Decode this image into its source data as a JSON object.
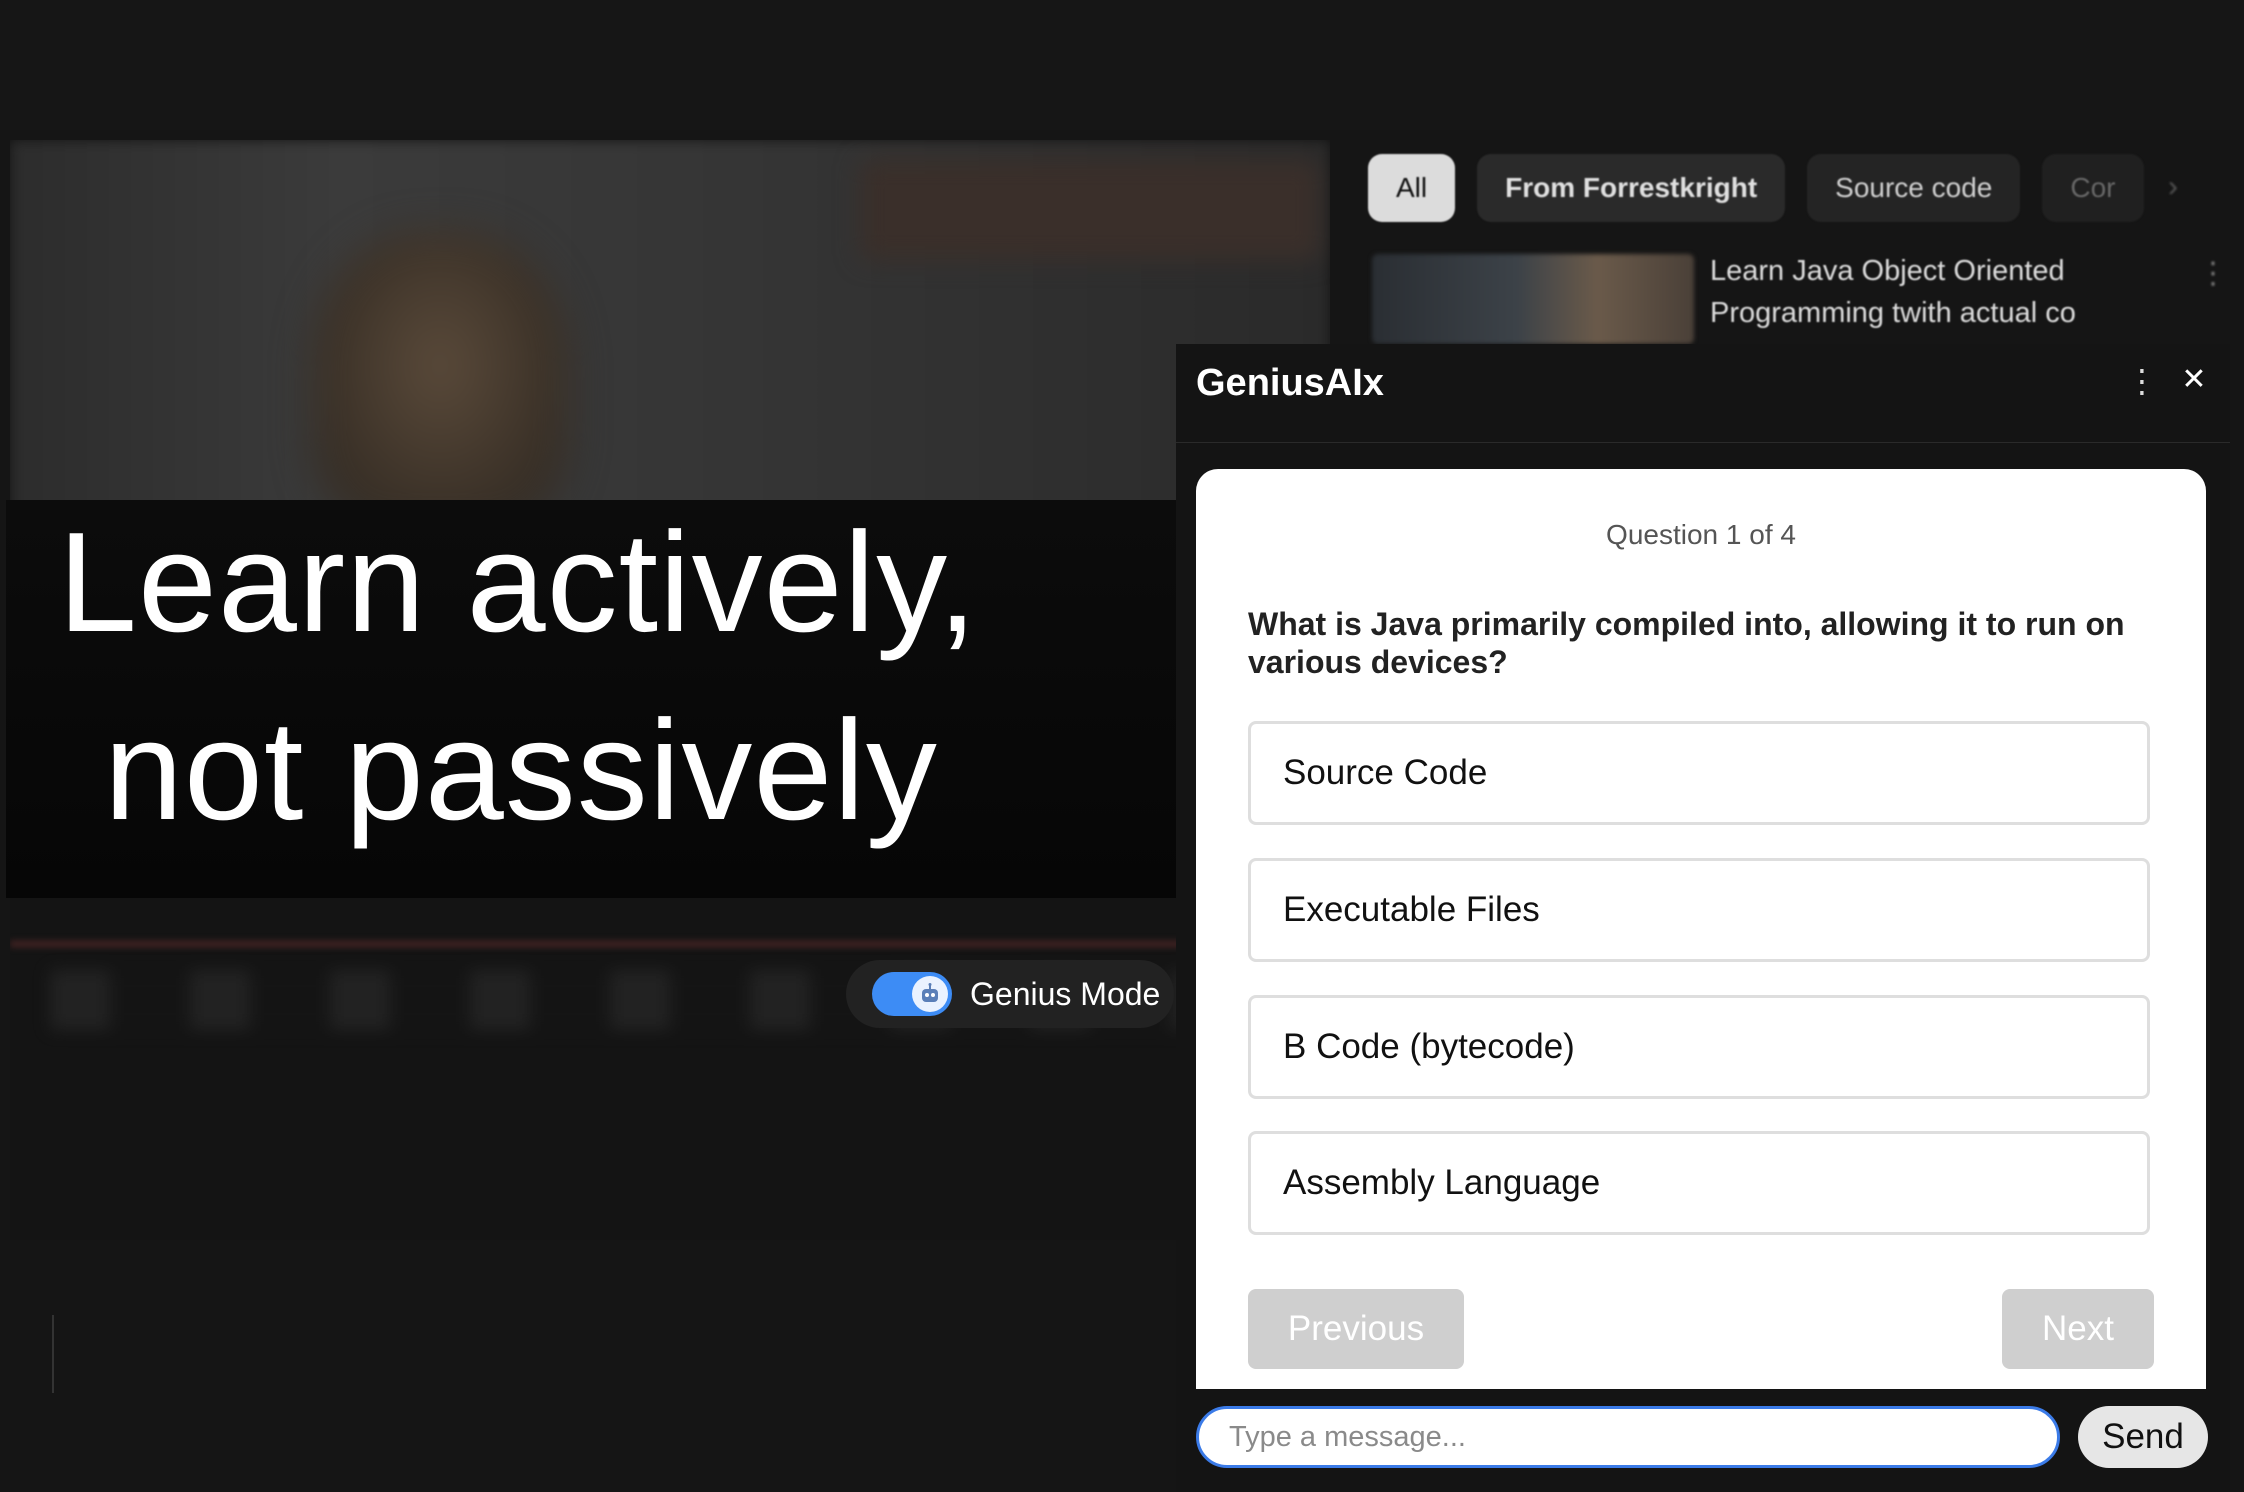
{
  "headline": {
    "line1": "Learn actively,",
    "line2": "not passively"
  },
  "genius_mode": {
    "label": "Genius Mode",
    "enabled": true,
    "knob_icon": "robot-icon"
  },
  "recommendations": {
    "chips": [
      "All",
      "From Forrestkright",
      "Source code",
      "Cor"
    ],
    "video": {
      "title_line1": "Learn Java Object Oriented",
      "title_line2": "Programming twith actual co"
    }
  },
  "panel": {
    "title": "GeniusAIx",
    "menu_icon": "kebab-menu-icon",
    "close_icon": "close-icon",
    "quiz": {
      "counter": "Question 1 of 4",
      "question": "What is Java primarily compiled into, allowing it to run on various devices?",
      "options": [
        "Source Code",
        "Executable Files",
        "B Code (bytecode)",
        "Assembly Language"
      ],
      "previous_label": "Previous",
      "next_label": "Next"
    },
    "chat": {
      "placeholder": "Type a message...",
      "value": "",
      "send_label": "Send",
      "accent": "#3b7be8"
    }
  }
}
